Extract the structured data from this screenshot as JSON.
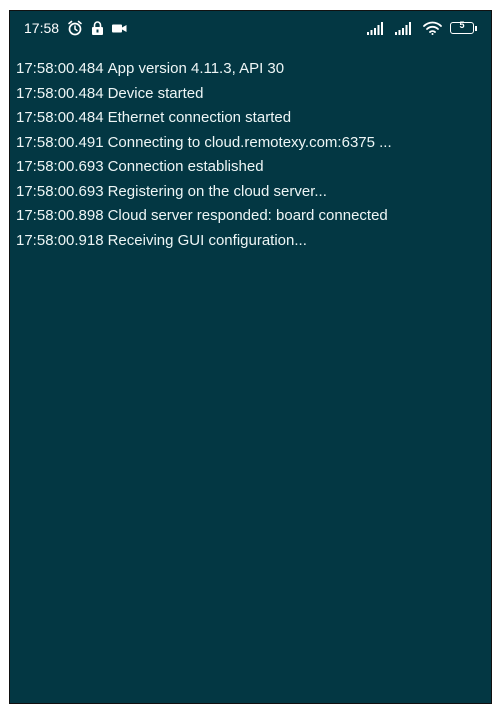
{
  "status_bar": {
    "time": "17:58",
    "left_icons": [
      "alarm-icon",
      "lock-icon",
      "video-camera-icon"
    ],
    "right_icons": [
      "signal-icon",
      "signal-icon",
      "wifi-icon",
      "battery-icon"
    ],
    "battery_level": "5"
  },
  "log": {
    "lines": [
      {
        "time": "17:58:00.484",
        "message": "App version 4.11.3, API 30"
      },
      {
        "time": "17:58:00.484",
        "message": "Device started"
      },
      {
        "time": "17:58:00.484",
        "message": "Ethernet connection started"
      },
      {
        "time": "17:58:00.491",
        "message": "Connecting to cloud.remotexy.com:6375 ..."
      },
      {
        "time": "17:58:00.693",
        "message": "Connection established"
      },
      {
        "time": "17:58:00.693",
        "message": "Registering on the cloud server..."
      },
      {
        "time": "17:58:00.898",
        "message": "Cloud server responded: board connected"
      },
      {
        "time": "17:58:00.918",
        "message": "Receiving GUI configuration..."
      }
    ]
  },
  "colors": {
    "background": "#033743",
    "text": "#eef6f6"
  }
}
